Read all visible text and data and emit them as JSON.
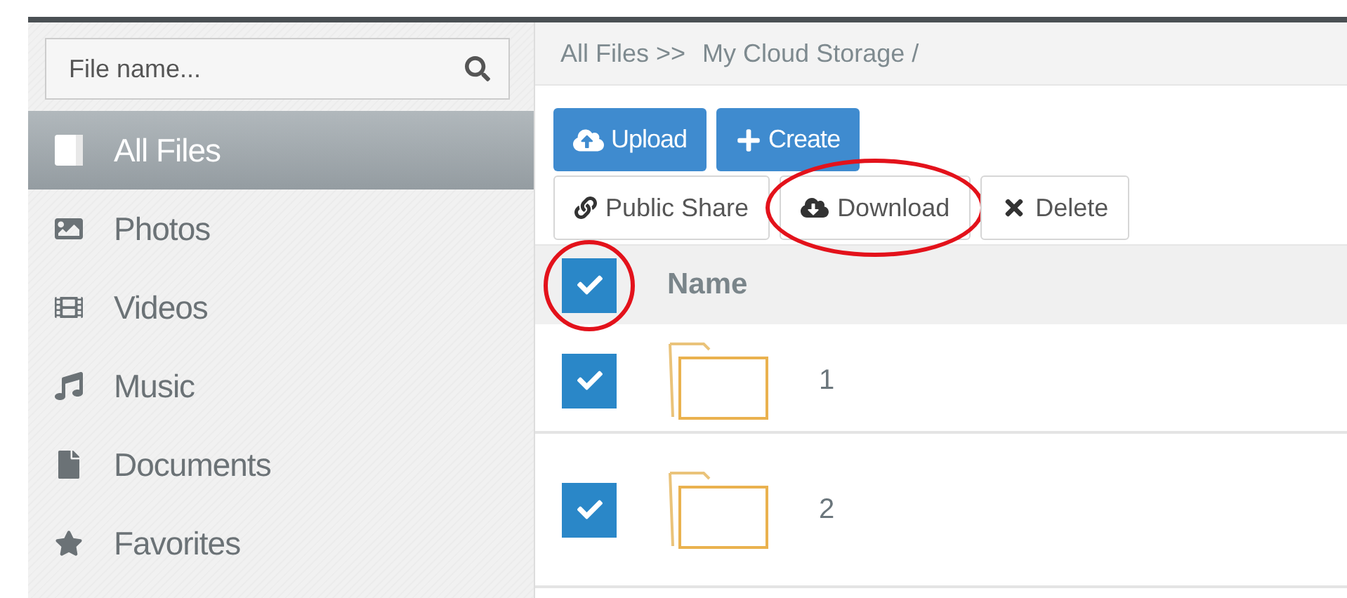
{
  "sidebar": {
    "search": {
      "placeholder": "File name..."
    },
    "items": [
      {
        "label": "All Files",
        "selected": true
      },
      {
        "label": "Photos",
        "selected": false
      },
      {
        "label": "Videos",
        "selected": false
      },
      {
        "label": "Music",
        "selected": false
      },
      {
        "label": "Documents",
        "selected": false
      },
      {
        "label": "Favorites",
        "selected": false
      }
    ]
  },
  "breadcrumb": [
    "All Files >>",
    "My Cloud Storage /"
  ],
  "primary_buttons": [
    {
      "label": "Upload"
    },
    {
      "label": "Create"
    }
  ],
  "action_buttons": [
    {
      "label": "Public Share",
      "highlighted": false
    },
    {
      "label": "Download",
      "highlighted": true
    },
    {
      "label": "Delete",
      "highlighted": false
    }
  ],
  "table": {
    "header": {
      "checked": true,
      "highlighted": true,
      "label": "Name"
    },
    "rows": [
      {
        "name": "1",
        "checked": true
      },
      {
        "name": "2",
        "checked": true
      }
    ]
  }
}
